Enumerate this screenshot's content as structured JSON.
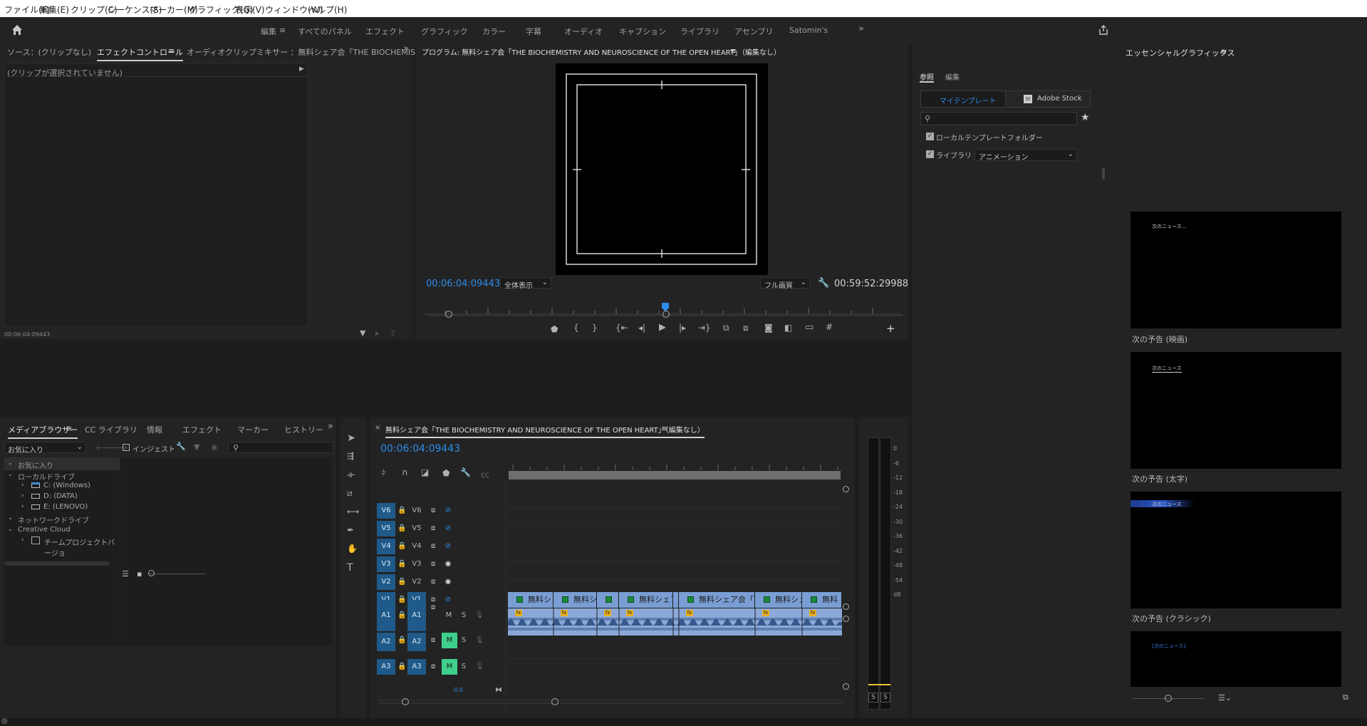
{
  "menu": [
    "ファイル(F)",
    "編集(E)",
    "クリップ(C)",
    "シーケンス(S)",
    "マーカー(M)",
    "グラフィック(G)",
    "表示(V)",
    "ウィンドウ(W)",
    "ヘルプ(H)"
  ],
  "workspaces": {
    "active": "編集",
    "items": [
      "すべてのパネル",
      "エフェクト",
      "グラフィック",
      "カラー",
      "字幕",
      "オーディオ",
      "キャプション",
      "ライブラリ",
      "アセンブリ",
      "Satomin's"
    ]
  },
  "source_panel": {
    "tabs": [
      "ソース：(クリップなし)",
      "エフェクトコントロール",
      "オーディオクリップミキサー ：無料シェア会「THE BIOCHEMISTRY AND"
    ],
    "no_clip_msg": "(クリップが選択されていません)",
    "timecode": "00:06:04:09443"
  },
  "program_monitor": {
    "title": "プログラム: 無料シェア会「THE BIOCHEMISTRY AND NEUROSCIENCE OF THE OPEN HEART」（編集なし）",
    "timecode": "00:06:04:09443",
    "zoom": "全体表示",
    "quality": "フル画質",
    "duration": "00:59:52:29988"
  },
  "media_browser": {
    "tabs": [
      "メディアブラウザー",
      "CC ライブラリ",
      "情報",
      "エフェクト",
      "マーカー",
      "ヒストリー"
    ],
    "favorites_dropdown": "お気に入り",
    "ingest_label": "インジェスト",
    "tree": {
      "favorites": "お気に入り",
      "local_drives": "ローカルドライブ",
      "drives": [
        "C: (Windows)",
        "D: (DATA)",
        "E: (LENOVO)"
      ],
      "network_drives": "ネットワークドライブ",
      "creative_cloud": "Creative Cloud",
      "team_project": "チームプロジェクトバージョ"
    }
  },
  "timeline": {
    "title": "無料シェア会「THE BIOCHEMISTRY AND NEUROSCIENCE OF THE OPEN HEART」（編集なし）",
    "timecode": "00:06:04:09443",
    "video_tracks": [
      {
        "src": "V6",
        "name": "V6",
        "eye": "hidden"
      },
      {
        "src": "V5",
        "name": "V5",
        "eye": "hidden"
      },
      {
        "src": "V4",
        "name": "V4",
        "eye": "hidden"
      },
      {
        "src": "V3",
        "name": "V3",
        "eye": "visible"
      },
      {
        "src": "V2",
        "name": "V2",
        "eye": "visible"
      },
      {
        "src": "V1",
        "name": "V1",
        "eye": "hidden"
      }
    ],
    "audio_tracks": [
      {
        "src": "A1",
        "name": "A1",
        "m": "M",
        "s": "S",
        "muted": false
      },
      {
        "src": "A2",
        "name": "A2",
        "m": "M",
        "s": "S",
        "muted": true
      },
      {
        "src": "A3",
        "name": "A3",
        "m": "M",
        "s": "S",
        "muted": true
      }
    ],
    "clips": [
      "無料シェ",
      "無料シェ",
      "",
      "無料シェア",
      "無料シェア会「THE",
      "無料シェ",
      "無料"
    ],
    "bottom_time": "0.0"
  },
  "audio_meter": {
    "scale": [
      "0",
      "-6",
      "-12",
      "-18",
      "-24",
      "-30",
      "-36",
      "-42",
      "-48",
      "-54",
      "dB"
    ],
    "solo": [
      "S",
      "S"
    ]
  },
  "essential_graphics": {
    "title": "エッセンシャルグラフィックス",
    "tabs": [
      "参照",
      "編集"
    ],
    "buttons": [
      "マイテンプレート",
      "Adobe Stock"
    ],
    "stock_badge": "St",
    "local_folder": "ローカルテンプレートフォルダー",
    "library_label": "ライブラリ",
    "library_value": "アニメーション",
    "templates": [
      {
        "label": "次の予告 (映画)",
        "preview": "次のニュース..."
      },
      {
        "label": "次の予告 (太字)",
        "preview": "次のニュース"
      },
      {
        "label": "次の予告 (クラシック)",
        "preview": "次のニュース"
      },
      {
        "label": "",
        "preview": "[次のニュース]"
      }
    ]
  },
  "colors": {
    "accent": "#2d8ceb",
    "mute": "#3fcf8c",
    "clip": "#7a9ed4"
  }
}
